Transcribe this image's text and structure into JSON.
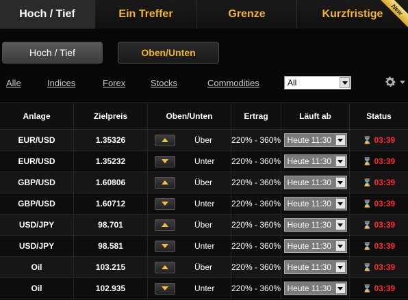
{
  "tabs": [
    {
      "label": "Hoch / Tief",
      "active": true
    },
    {
      "label": "Ein Treffer",
      "active": false
    },
    {
      "label": "Grenze",
      "active": false
    },
    {
      "label": "Kurzfristige",
      "active": false,
      "badge": "New"
    }
  ],
  "subtabs": [
    {
      "label": "Hoch / Tief"
    },
    {
      "label": "Oben/Unten"
    }
  ],
  "filters": [
    "Alle",
    "Indices",
    "Forex",
    "Stocks",
    "Commodities"
  ],
  "asset_select": {
    "value": "All"
  },
  "columns": [
    "Anlage",
    "Zielpreis",
    "Oben/Unten",
    "Ertrag",
    "Läuft ab",
    "Status"
  ],
  "rows": [
    {
      "asset": "EUR/USD",
      "price": "1.35326",
      "direction": "Über",
      "dir": "up",
      "payout": "220% - 360%",
      "expiry": "Heute 11:30",
      "status": "03:39"
    },
    {
      "asset": "EUR/USD",
      "price": "1.35232",
      "direction": "Unter",
      "dir": "down",
      "payout": "220% - 360%",
      "expiry": "Heute 11:30",
      "status": "03:39"
    },
    {
      "asset": "GBP/USD",
      "price": "1.60806",
      "direction": "Über",
      "dir": "up",
      "payout": "220% - 360%",
      "expiry": "Heute 11:30",
      "status": "03:39"
    },
    {
      "asset": "GBP/USD",
      "price": "1.60712",
      "direction": "Unter",
      "dir": "down",
      "payout": "220% - 360%",
      "expiry": "Heute 11:30",
      "status": "03:39"
    },
    {
      "asset": "USD/JPY",
      "price": "98.701",
      "direction": "Über",
      "dir": "up",
      "payout": "220% - 360%",
      "expiry": "Heute 11:30",
      "status": "03:39"
    },
    {
      "asset": "USD/JPY",
      "price": "98.581",
      "direction": "Unter",
      "dir": "down",
      "payout": "220% - 360%",
      "expiry": "Heute 11:30",
      "status": "03:39"
    },
    {
      "asset": "Oil",
      "price": "103.215",
      "direction": "Über",
      "dir": "up",
      "payout": "220% - 360%",
      "expiry": "Heute 11:30",
      "status": "03:39"
    },
    {
      "asset": "Oil",
      "price": "102.935",
      "direction": "Unter",
      "dir": "down",
      "payout": "220% - 360%",
      "expiry": "Heute 11:30",
      "status": "03:39"
    }
  ],
  "icons": {
    "settings": "gear-icon",
    "status": "hourglass-icon",
    "up": "arrow-up-icon",
    "down": "arrow-down-icon"
  },
  "colors": {
    "accent": "#f2b630",
    "timer": "#ff2a2a",
    "background": "#070707"
  }
}
